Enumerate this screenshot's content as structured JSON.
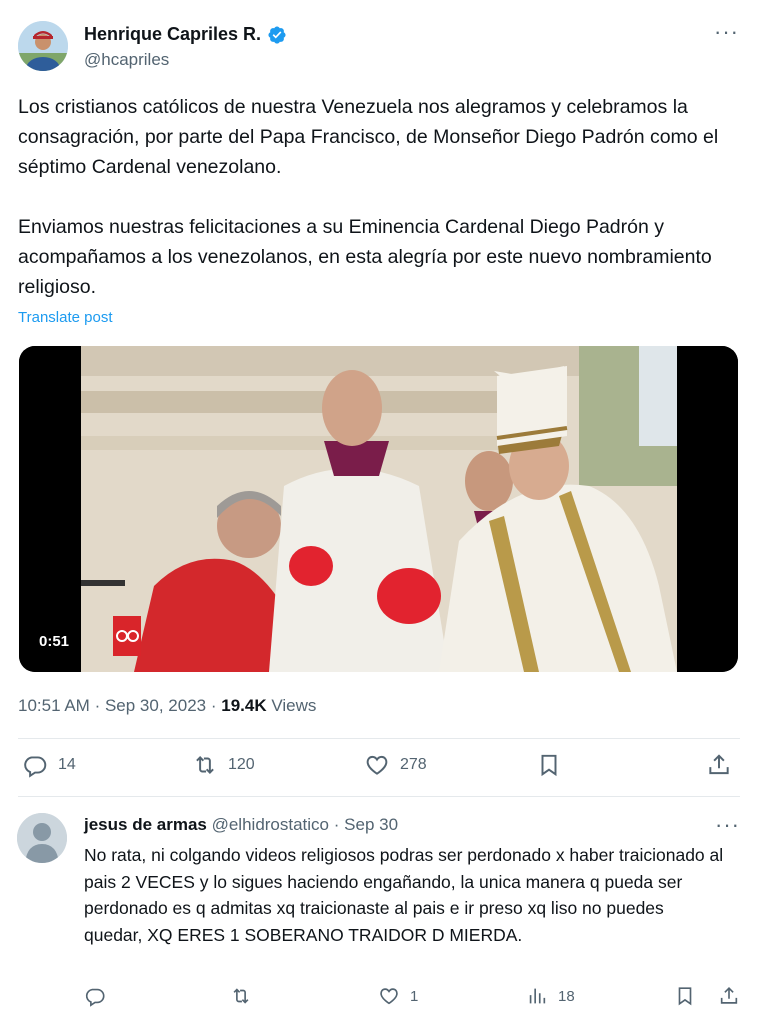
{
  "tweet": {
    "author_name": "Henrique Capriles R.",
    "author_handle": "@hcapriles",
    "more_label": "···",
    "paragraph_1": "Los cristianos católicos de nuestra Venezuela nos alegramos y celebramos la consagración, por parte del Papa Francisco, de Monseñor Diego Padrón como el séptimo Cardenal venezolano.",
    "paragraph_2": "Enviamos nuestras felicitaciones a su Eminencia Cardenal Diego Padrón y acompañamos a los venezolanos, en esta alegría por este nuevo nombramiento religioso.",
    "translate_label": "Translate post",
    "video_duration": "0:51",
    "time": "10:51 AM",
    "date": "Sep 30, 2023",
    "views_count": "19.4K",
    "views_label": "Views",
    "replies": "14",
    "reposts": "120",
    "likes": "278"
  },
  "reply": {
    "name": "jesus de armas",
    "handle": "@elhidrostatico",
    "date": "Sep 30",
    "more_label": "···",
    "text": "No rata, ni colgando videos religiosos podras ser perdonado x haber traicionado al pais 2 VECES y lo sigues haciendo engañando, la unica manera q pueda ser perdonado es q admitas xq traicionaste al pais e ir preso xq liso no puedes quedar, XQ ERES 1 SOBERANO TRAIDOR D MIERDA.",
    "likes": "1",
    "views": "18"
  },
  "colors": {
    "accent": "#1d9bf0",
    "text_primary": "#0f1419",
    "text_secondary": "#536471"
  },
  "icons": [
    "verified-badge-icon",
    "more-icon",
    "reply-icon",
    "repost-icon",
    "like-icon",
    "bookmark-icon",
    "share-icon",
    "views-icon"
  ]
}
